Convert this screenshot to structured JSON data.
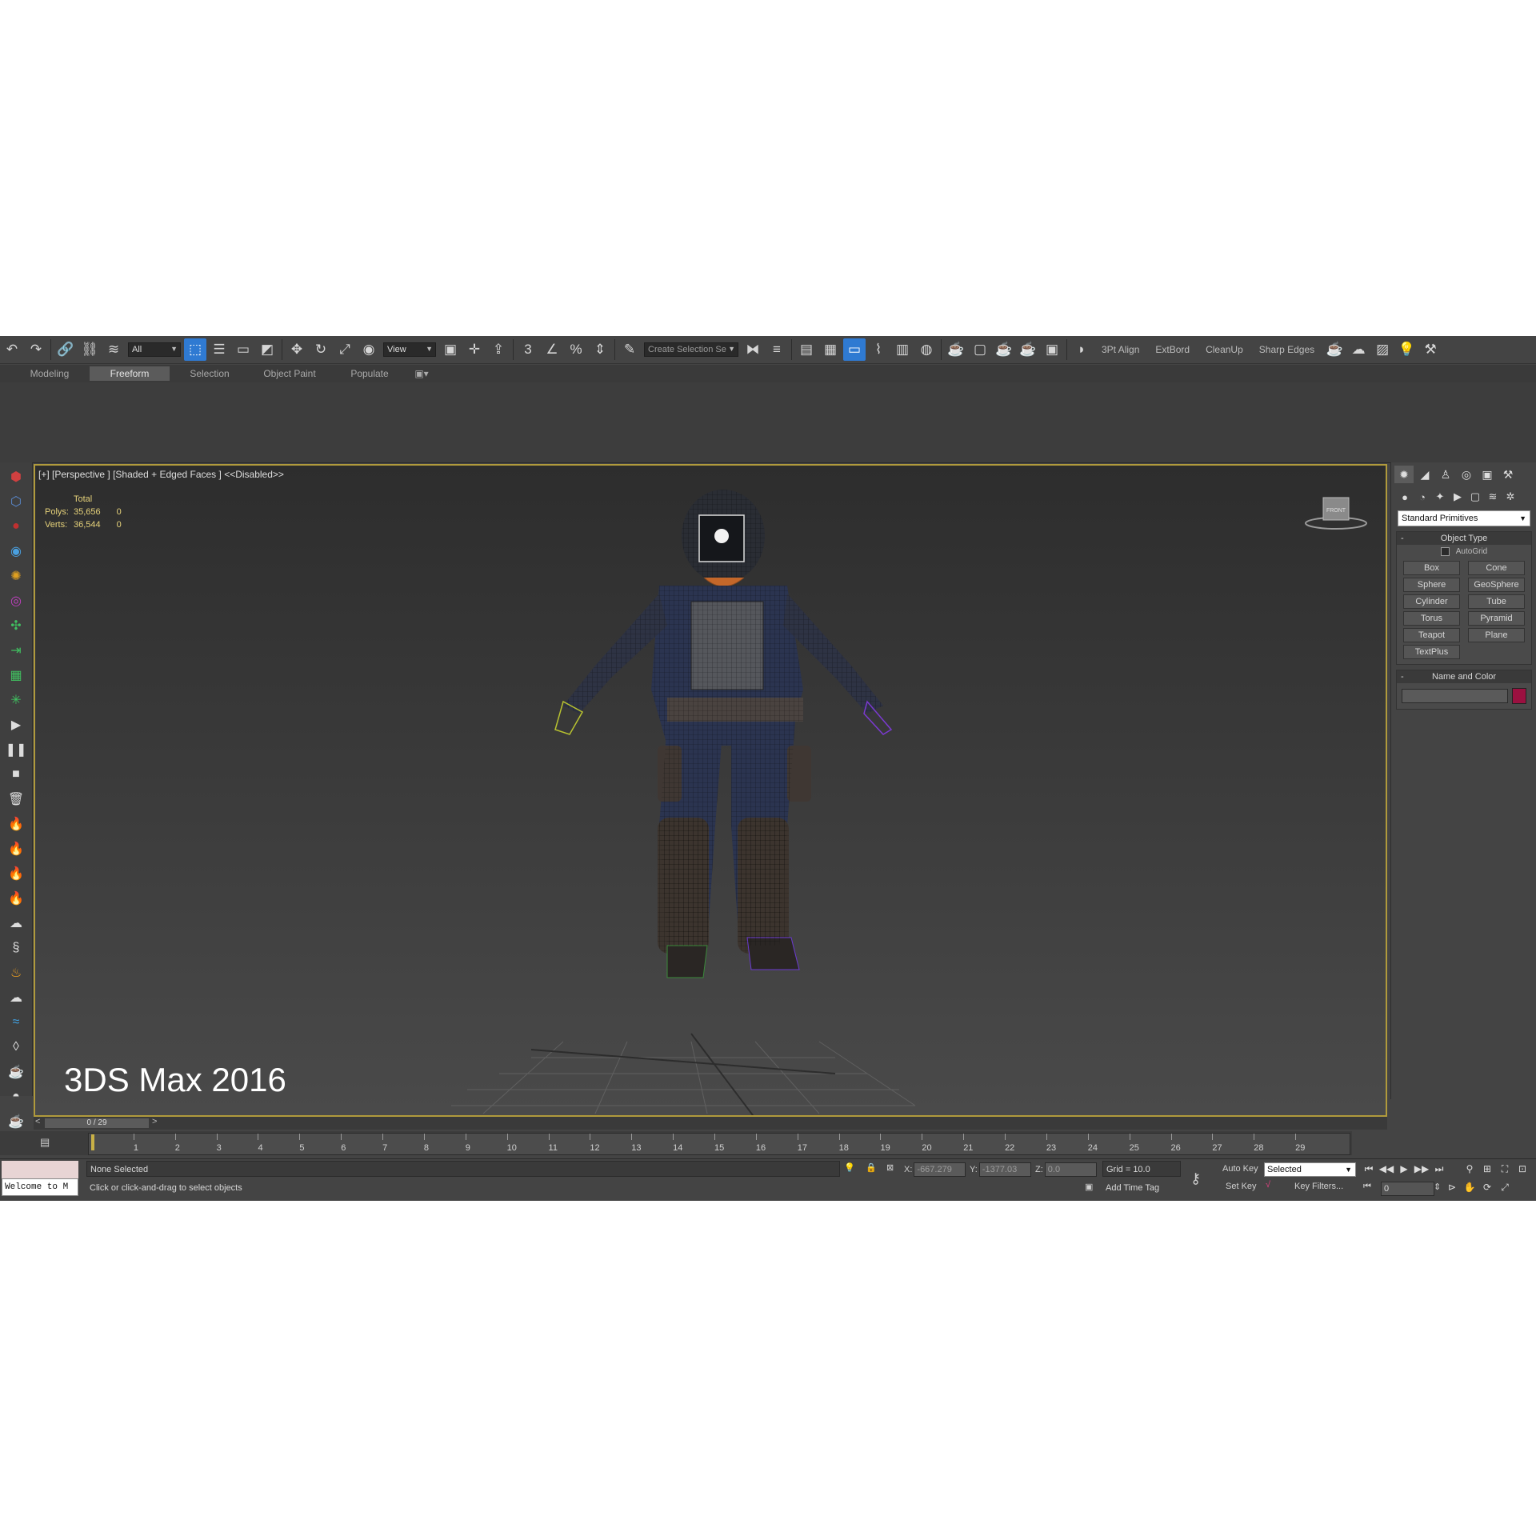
{
  "toolbar": {
    "selection_filter": "All",
    "reference_coord": "View",
    "named_selection_placeholder": "Create Selection Se",
    "text_buttons": [
      "3Pt Align",
      "ExtBord",
      "CleanUp",
      "Sharp Edges"
    ]
  },
  "ribbon": {
    "tabs": [
      "Modeling",
      "Freeform",
      "Selection",
      "Object Paint",
      "Populate"
    ],
    "active_tab": "Freeform"
  },
  "viewport": {
    "label_plus": "[+]",
    "label_view": "[Perspective ]",
    "label_shading": "[Shaded + Edged Faces ]",
    "label_disabled": "<<Disabled>>",
    "stats": {
      "header": "Total",
      "polys_label": "Polys:",
      "polys_total": "35,656",
      "polys_sel": "0",
      "verts_label": "Verts:",
      "verts_total": "36,544",
      "verts_sel": "0"
    },
    "watermark": "3DS Max 2016",
    "viewcube_label": "FRONT"
  },
  "command_panel": {
    "category": "Standard Primitives",
    "object_type_title": "Object Type",
    "autogrid_label": "AutoGrid",
    "primitives": [
      "Box",
      "Cone",
      "Sphere",
      "GeoSphere",
      "Cylinder",
      "Tube",
      "Torus",
      "Pyramid",
      "Teapot",
      "Plane",
      "TextPlus"
    ],
    "name_color_title": "Name and Color",
    "object_color": "#9b1040"
  },
  "timeline": {
    "time_slider": "0 / 29",
    "ticks": [
      "1",
      "2",
      "3",
      "4",
      "5",
      "6",
      "7",
      "8",
      "9",
      "10",
      "11",
      "12",
      "13",
      "14",
      "15",
      "16",
      "17",
      "18",
      "19",
      "20",
      "21",
      "22",
      "23",
      "24",
      "25",
      "26",
      "27",
      "28",
      "29"
    ],
    "start_tick": "0"
  },
  "status": {
    "maxscript_text": "Welcome to M",
    "selection_status": "None Selected",
    "prompt": "Click or click-and-drag to select objects",
    "x_label": "X:",
    "x_value": "-667.279",
    "y_label": "Y:",
    "y_value": "-1377.03",
    "z_label": "Z:",
    "z_value": "0.0",
    "grid": "Grid = 10.0",
    "add_time_tag": "Add Time Tag",
    "auto_key": "Auto Key",
    "set_key": "Set Key",
    "key_mode": "Selected",
    "key_filters": "Key Filters...",
    "frame_value": "0"
  },
  "colors": {
    "accent_blue": "#2f7ad2",
    "viewport_border": "#b09a3c",
    "stats_yellow": "#e6d27a"
  }
}
